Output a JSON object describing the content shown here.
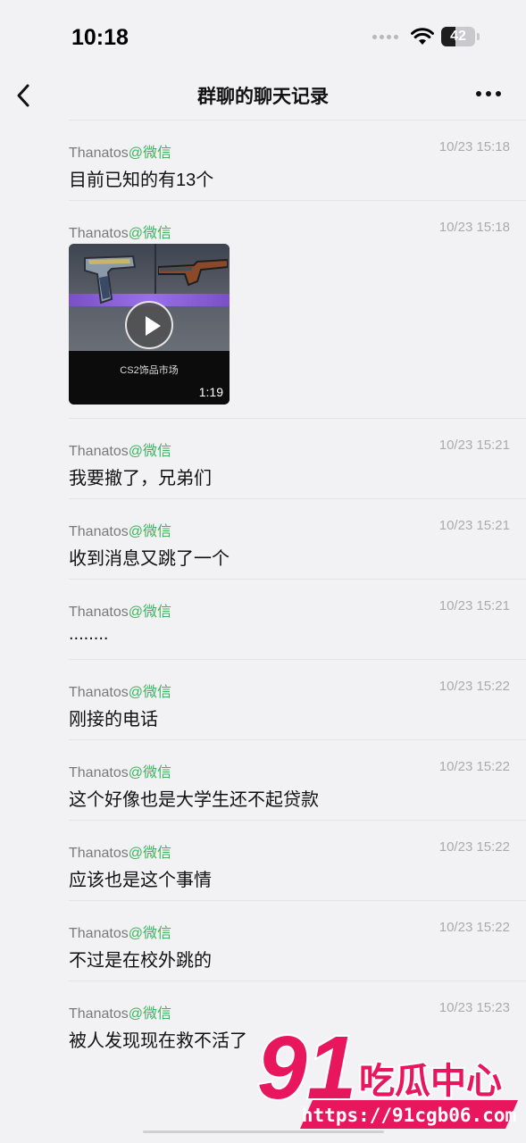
{
  "status": {
    "time": "10:18",
    "battery": "42",
    "battery_level": 0.42
  },
  "nav": {
    "title": "群聊的聊天记录"
  },
  "messages": [
    {
      "sender": "Thanatos",
      "platform": "@微信",
      "time": "10/23 15:18",
      "text": "目前已知的有13个"
    },
    {
      "sender": "Thanatos",
      "platform": "@微信",
      "time": "10/23 15:18",
      "video": {
        "caption": "CS2饰品市场",
        "duration": "1:19"
      }
    },
    {
      "sender": "Thanatos",
      "platform": "@微信",
      "time": "10/23 15:21",
      "text": "我要撤了，兄弟们"
    },
    {
      "sender": "Thanatos",
      "platform": "@微信",
      "time": "10/23 15:21",
      "text": "收到消息又跳了一个"
    },
    {
      "sender": "Thanatos",
      "platform": "@微信",
      "time": "10/23 15:21",
      "text": "........"
    },
    {
      "sender": "Thanatos",
      "platform": "@微信",
      "time": "10/23 15:22",
      "text": "刚接的电话"
    },
    {
      "sender": "Thanatos",
      "platform": "@微信",
      "time": "10/23 15:22",
      "text": "这个好像也是大学生还不起贷款"
    },
    {
      "sender": "Thanatos",
      "platform": "@微信",
      "time": "10/23 15:22",
      "text": "应该也是这个事情"
    },
    {
      "sender": "Thanatos",
      "platform": "@微信",
      "time": "10/23 15:22",
      "text": "不过是在校外跳的"
    },
    {
      "sender": "Thanatos",
      "platform": "@微信",
      "time": "10/23 15:23",
      "text": "被人发现现在救不活了"
    }
  ],
  "watermark": {
    "logo": "91",
    "brand": "吃瓜中心",
    "url": "https://91cgb06.com",
    "color": "#e8175d"
  }
}
